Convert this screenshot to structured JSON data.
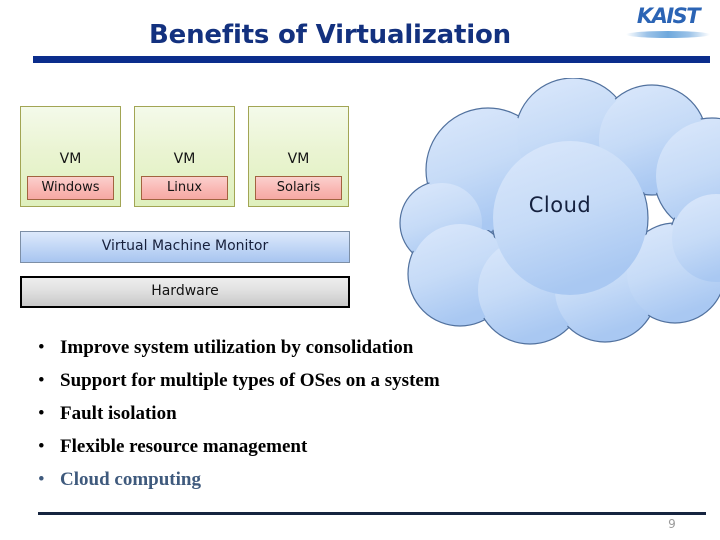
{
  "slide": {
    "title": "Benefits of Virtualization",
    "page_number": "9",
    "accent_color": "#0b2d8c",
    "footer_rule_color": "#16243f"
  },
  "logo": {
    "wordmark": "KAIST",
    "swoosh_name": "swoosh-underline",
    "color": "#2b64b5"
  },
  "diagram": {
    "vms": [
      {
        "title": "VM",
        "os": "Windows"
      },
      {
        "title": "VM",
        "os": "Linux"
      },
      {
        "title": "VM",
        "os": "Solaris"
      }
    ],
    "vmm_label": "Virtual Machine Monitor",
    "hardware_label": "Hardware",
    "vm_fill": "#eaf4d2",
    "os_fill": "#f9b8b4",
    "vmm_fill": "#c2d7f6",
    "hardware_fill": "#e2e2e2"
  },
  "cloud": {
    "label": "Cloud",
    "fill": "#c3d9f6",
    "stroke": "#51719e"
  },
  "bullets": [
    {
      "text": "Improve system utilization by consolidation",
      "accent": false
    },
    {
      "text": "Support for multiple types of OSes on a system",
      "accent": false
    },
    {
      "text": "Fault isolation",
      "accent": false
    },
    {
      "text": "Flexible resource management",
      "accent": false
    },
    {
      "text": "Cloud computing",
      "accent": true
    }
  ],
  "bullet_marker": "•",
  "bullet_accent_color": "#3f5a7d"
}
